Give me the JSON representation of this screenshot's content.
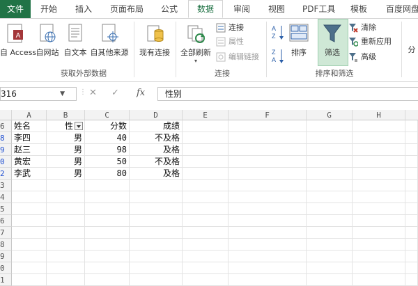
{
  "tabs": [
    "文件",
    "开始",
    "插入",
    "页面布局",
    "公式",
    "数据",
    "审阅",
    "视图",
    "PDF工具",
    "模板",
    "百度网盘"
  ],
  "active_tab": "数据",
  "ribbon": {
    "get_external": {
      "access": "自 Access",
      "web": "自网站",
      "text": "自文本",
      "other": "自其他来源",
      "existing": "现有连接",
      "group_label": "获取外部数据"
    },
    "connections": {
      "refresh_all": "全部刷新",
      "connections": "连接",
      "properties": "属性",
      "edit_links": "编辑链接",
      "group_label": "连接"
    },
    "sort_filter": {
      "sort": "排序",
      "filter": "筛选",
      "clear": "清除",
      "reapply": "重新应用",
      "advanced": "高级",
      "group_label": "排序和筛选",
      "sort_az_top": "A",
      "sort_az_bottom": "Z",
      "sort_za_top": "Z",
      "sort_za_bottom": "A"
    },
    "split": "分"
  },
  "formula_bar": {
    "name_box": "316",
    "cancel": "✕",
    "enter": "✓",
    "fx": "fx",
    "content": "性别"
  },
  "columns": [
    "A",
    "B",
    "C",
    "D",
    "E",
    "F",
    "G",
    "H"
  ],
  "rows": [
    {
      "num": "6",
      "a": "姓名",
      "b": "性",
      "c": "分数",
      "d": "成绩",
      "blue": false
    },
    {
      "num": "8",
      "a": "李四",
      "b": "男",
      "c": "40",
      "d": "不及格",
      "blue": true
    },
    {
      "num": "9",
      "a": "赵三",
      "b": "男",
      "c": "98",
      "d": "及格",
      "blue": true
    },
    {
      "num": "0",
      "a": "黄宏",
      "b": "男",
      "c": "50",
      "d": "不及格",
      "blue": true
    },
    {
      "num": "2",
      "a": "李武",
      "b": "男",
      "c": "80",
      "d": "及格",
      "blue": true
    },
    {
      "num": "3",
      "a": "",
      "b": "",
      "c": "",
      "d": "",
      "blue": false
    },
    {
      "num": "4",
      "a": "",
      "b": "",
      "c": "",
      "d": "",
      "blue": false
    },
    {
      "num": "5",
      "a": "",
      "b": "",
      "c": "",
      "d": "",
      "blue": false
    },
    {
      "num": "6",
      "a": "",
      "b": "",
      "c": "",
      "d": "",
      "blue": false
    },
    {
      "num": "7",
      "a": "",
      "b": "",
      "c": "",
      "d": "",
      "blue": false
    },
    {
      "num": "8",
      "a": "",
      "b": "",
      "c": "",
      "d": "",
      "blue": false
    },
    {
      "num": "9",
      "a": "",
      "b": "",
      "c": "",
      "d": "",
      "blue": false
    },
    {
      "num": "0",
      "a": "",
      "b": "",
      "c": "",
      "d": "",
      "blue": false
    },
    {
      "num": "1",
      "a": "",
      "b": "",
      "c": "",
      "d": "",
      "blue": false
    }
  ],
  "colors": {
    "excel_green": "#217346",
    "filter_highlight": "#cfe8d6",
    "row_blue": "#1f4fd1"
  }
}
